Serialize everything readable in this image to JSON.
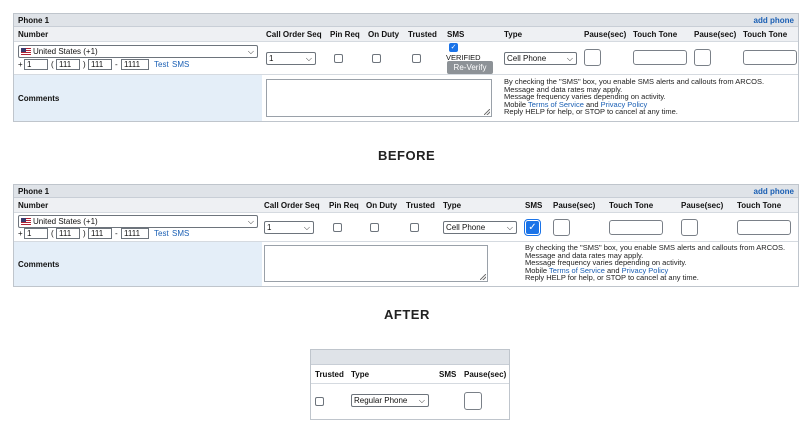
{
  "section_title": "Phone 1",
  "add_phone": "add phone",
  "columns": {
    "number": "Number",
    "call_order_seq": "Call Order Seq",
    "pin_req": "Pin Req",
    "on_duty": "On Duty",
    "trusted": "Trusted",
    "sms": "SMS",
    "type": "Type",
    "pause_sec": "Pause(sec)",
    "touch_tone": "Touch Tone"
  },
  "phone": {
    "country": "United States (+1)",
    "prefix_plus": "+",
    "country_code": "1",
    "paren_open": "(",
    "paren_close": ")",
    "area_code": "111",
    "exchange": "111",
    "dash": "-",
    "line": "1111",
    "test_link": "Test",
    "sms_link": "SMS",
    "call_order_value": "1",
    "type_value": "Cell Phone"
  },
  "sms_status": {
    "verified": "VERIFIED",
    "reverify": "Re-Verify",
    "checked": true
  },
  "comments_label": "Comments",
  "disclaimer": {
    "line1": "By checking the \"SMS\" box, you enable SMS alerts and callouts from ARCOS.",
    "line2": "Message and data rates may apply.",
    "line3": "Message frequency varies depending on activity.",
    "line4_prefix": "Mobile",
    "terms": "Terms of Service",
    "and": "and",
    "privacy": "Privacy Policy",
    "line5": "Reply HELP for help, or STOP to cancel at any time."
  },
  "captions": {
    "before": "BEFORE",
    "after": "AFTER"
  },
  "zoom": {
    "trusted": "Trusted",
    "type": "Type",
    "sms": "SMS",
    "pause": "Pause(sec)",
    "type_value": "Regular Phone"
  },
  "icons": {
    "flag": "us-flag-icon",
    "dropdown": "chevron-down-icon",
    "check": "checkmark-icon",
    "resize": "resize-grip-icon"
  },
  "colors": {
    "header_bar": "#dfe3e8",
    "comments_bg": "#e4eef8",
    "link": "#1a5fb4",
    "checkbox_checked": "#1a73e8",
    "reverify_button": "#8d9297"
  }
}
